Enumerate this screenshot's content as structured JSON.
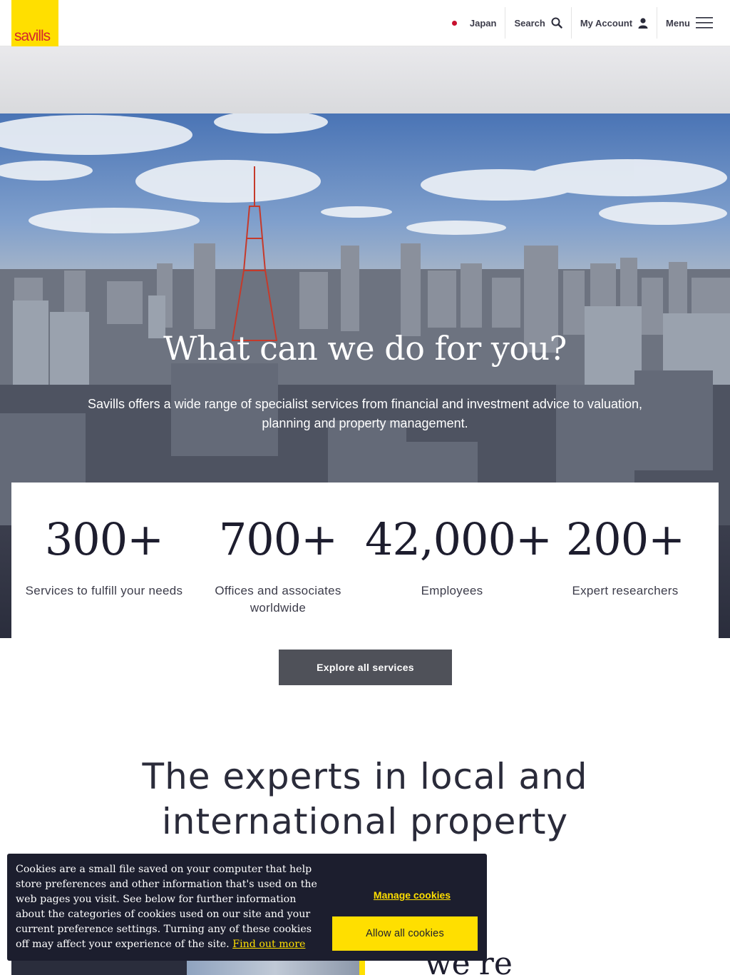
{
  "header": {
    "logo_text": "savills",
    "region_label": "Japan",
    "search_label": "Search",
    "account_label": "My Account",
    "menu_label": "Menu"
  },
  "hero": {
    "title": "What can we do for you?",
    "subtitle": "Savills offers a wide range of specialist services from financial and investment advice to valuation, planning and property management."
  },
  "stats": [
    {
      "value": "300+",
      "label": "Services to fulfill your needs"
    },
    {
      "value": "700+",
      "label": "Offices and associates worldwide"
    },
    {
      "value": "42,000+",
      "label": "Employees"
    },
    {
      "value": "200+",
      "label": "Expert researchers"
    }
  ],
  "explore_button": "Explore all services",
  "experts_heading": "The experts in local and international property",
  "bottom_partial_text": "we're",
  "cookie": {
    "text": "Cookies are a small file saved on your computer that help store preferences and other information that's used on the web pages you visit. See below for further information about the categories of cookies used on our site and your current preference settings. Turning any of these cookies off may affect your experience of the site.",
    "link": "Find out more",
    "manage": "Manage cookies",
    "allow": "Allow all cookies"
  },
  "colors": {
    "brand_yellow": "#ffdf00",
    "brand_red": "#c8102e",
    "dark_navy": "#1c1e2e",
    "button_grey": "#4f5159"
  }
}
